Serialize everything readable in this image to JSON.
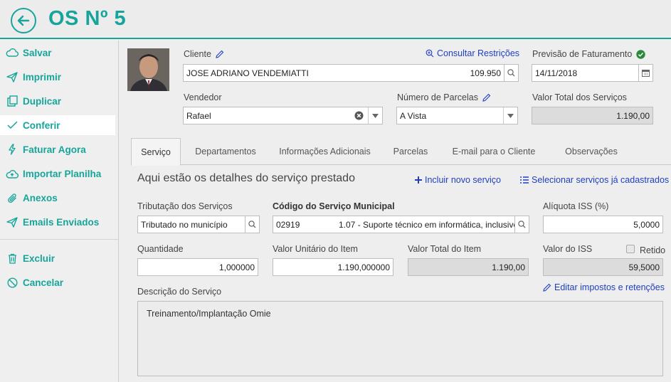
{
  "header": {
    "title": "OS Nº 5"
  },
  "sidebar": {
    "items": [
      {
        "label": "Salvar"
      },
      {
        "label": "Imprimir"
      },
      {
        "label": "Duplicar"
      },
      {
        "label": "Conferir"
      },
      {
        "label": "Faturar Agora"
      },
      {
        "label": "Importar Planilha"
      },
      {
        "label": "Anexos"
      },
      {
        "label": "Emails Enviados"
      },
      {
        "label": "Excluir"
      },
      {
        "label": "Cancelar"
      }
    ]
  },
  "client": {
    "label": "Cliente",
    "value": "JOSE ADRIANO VENDEMIATTI",
    "code": "109.950",
    "restrictions_link": "Consultar Restrições"
  },
  "billing": {
    "label": "Previsão de Faturamento",
    "date": "14/11/2018"
  },
  "seller": {
    "label": "Vendedor",
    "value": "Rafael"
  },
  "installments": {
    "label": "Número de Parcelas",
    "value": "A Vista"
  },
  "total_services": {
    "label": "Valor Total dos Serviços",
    "value": "1.190,00"
  },
  "tabs": [
    {
      "label": "Serviço"
    },
    {
      "label": "Departamentos"
    },
    {
      "label": "Informações Adicionais"
    },
    {
      "label": "Parcelas"
    },
    {
      "label": "E-mail para o Cliente"
    },
    {
      "label": "Observações"
    }
  ],
  "service": {
    "section_title": "Aqui estão os detalhes do serviço prestado",
    "add_link": "Incluir novo serviço",
    "select_link": "Selecionar serviços já cadastrados",
    "taxation_label": "Tributação dos Serviços",
    "taxation_value": "Tributado no município",
    "municipal_code_label": "Código do Serviço Municipal",
    "municipal_code": "02919",
    "municipal_desc": "1.07 - Suporte técnico em informática, inclusive",
    "iss_rate_label": "Alíquota ISS (%)",
    "iss_rate_value": "5,0000",
    "quantity_label": "Quantidade",
    "quantity_value": "1,000000",
    "unit_value_label": "Valor Unitário do Item",
    "unit_value": "1.190,000000",
    "item_total_label": "Valor Total do Item",
    "item_total_value": "1.190,00",
    "iss_value_label": "Valor do ISS",
    "iss_withheld_label": "Retido",
    "iss_value": "59,5000",
    "description_label": "Descrição do Serviço",
    "edit_taxes_link": "Editar impostos e retenções",
    "description": "Treinamento/Implantação Omie"
  },
  "colors": {
    "accent": "#16a59a",
    "link": "#1f3fbf",
    "ok_green": "#2a8a3a"
  }
}
